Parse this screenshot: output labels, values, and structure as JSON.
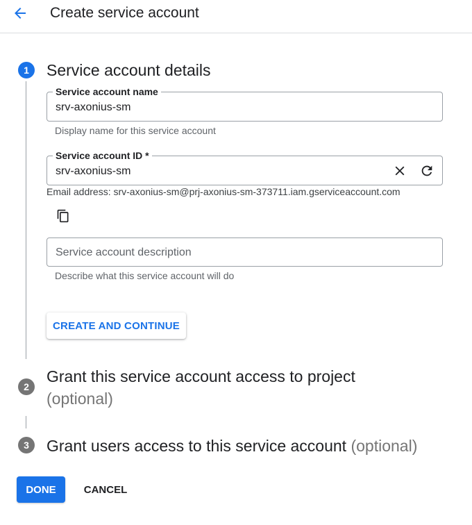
{
  "header": {
    "title": "Create service account",
    "back_icon": "arrow-back-icon"
  },
  "colors": {
    "accent": "#1a73e8",
    "inactive_step": "#757575",
    "border": "#9aa0a6"
  },
  "steps": [
    {
      "number": "1",
      "title": "Service account details",
      "optional": ""
    },
    {
      "number": "2",
      "title": "Grant this service account access to project",
      "optional": "(optional)"
    },
    {
      "number": "3",
      "title": "Grant users access to this service account",
      "optional": "(optional)"
    }
  ],
  "form": {
    "name": {
      "label": "Service account name",
      "value": "srv-axonius-sm",
      "hint": "Display name for this service account"
    },
    "id": {
      "label": "Service account ID *",
      "value": "srv-axonius-sm",
      "clear_icon": "close-icon",
      "refresh_icon": "refresh-icon"
    },
    "email": "Email address: srv-axonius-sm@prj-axonius-sm-373711.iam.gserviceaccount.com",
    "copy_icon": "copy-icon",
    "description": {
      "placeholder": "Service account description",
      "value": "",
      "hint": "Describe what this service account will do"
    }
  },
  "buttons": {
    "create_continue": "CREATE AND CONTINUE",
    "done": "DONE",
    "cancel": "CANCEL"
  }
}
